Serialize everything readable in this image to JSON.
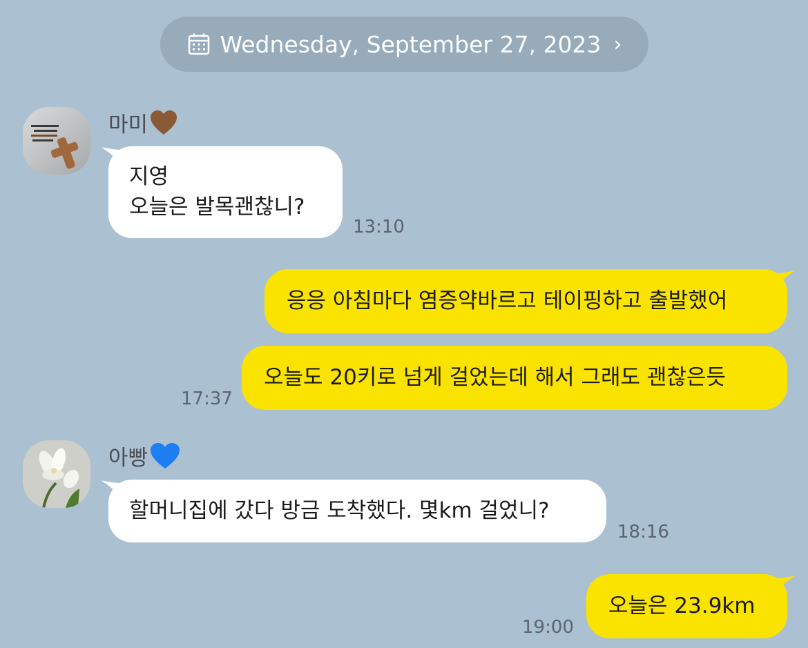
{
  "date_header": {
    "label": "Wednesday, September 27, 2023",
    "icon": "calendar-icon"
  },
  "messages": [
    {
      "sender": "마미",
      "sender_emoji": "brown-heart",
      "lines": [
        "지영",
        "오늘은 발목괜찮니?"
      ],
      "time": "13:10"
    },
    {
      "lines": [
        "응응 아침마다 염증약바르고 테이핑하고 출발했어"
      ]
    },
    {
      "lines": [
        "오늘도 20키로 넘게 걸었는데 해서 그래도 괜찮은듯"
      ],
      "time": "17:37"
    },
    {
      "sender": "아빵",
      "sender_emoji": "blue-heart",
      "lines": [
        "할머니집에 갔다 방금 도착했다. 몇km 걸었니?"
      ],
      "time": "18:16"
    },
    {
      "lines": [
        "오늘은 23.9km"
      ],
      "time": "19:00"
    }
  ],
  "colors": {
    "background": "#abc1d1",
    "incoming_bubble": "#ffffff",
    "outgoing_bubble": "#fbe300",
    "date_pill": "#97abbb"
  }
}
